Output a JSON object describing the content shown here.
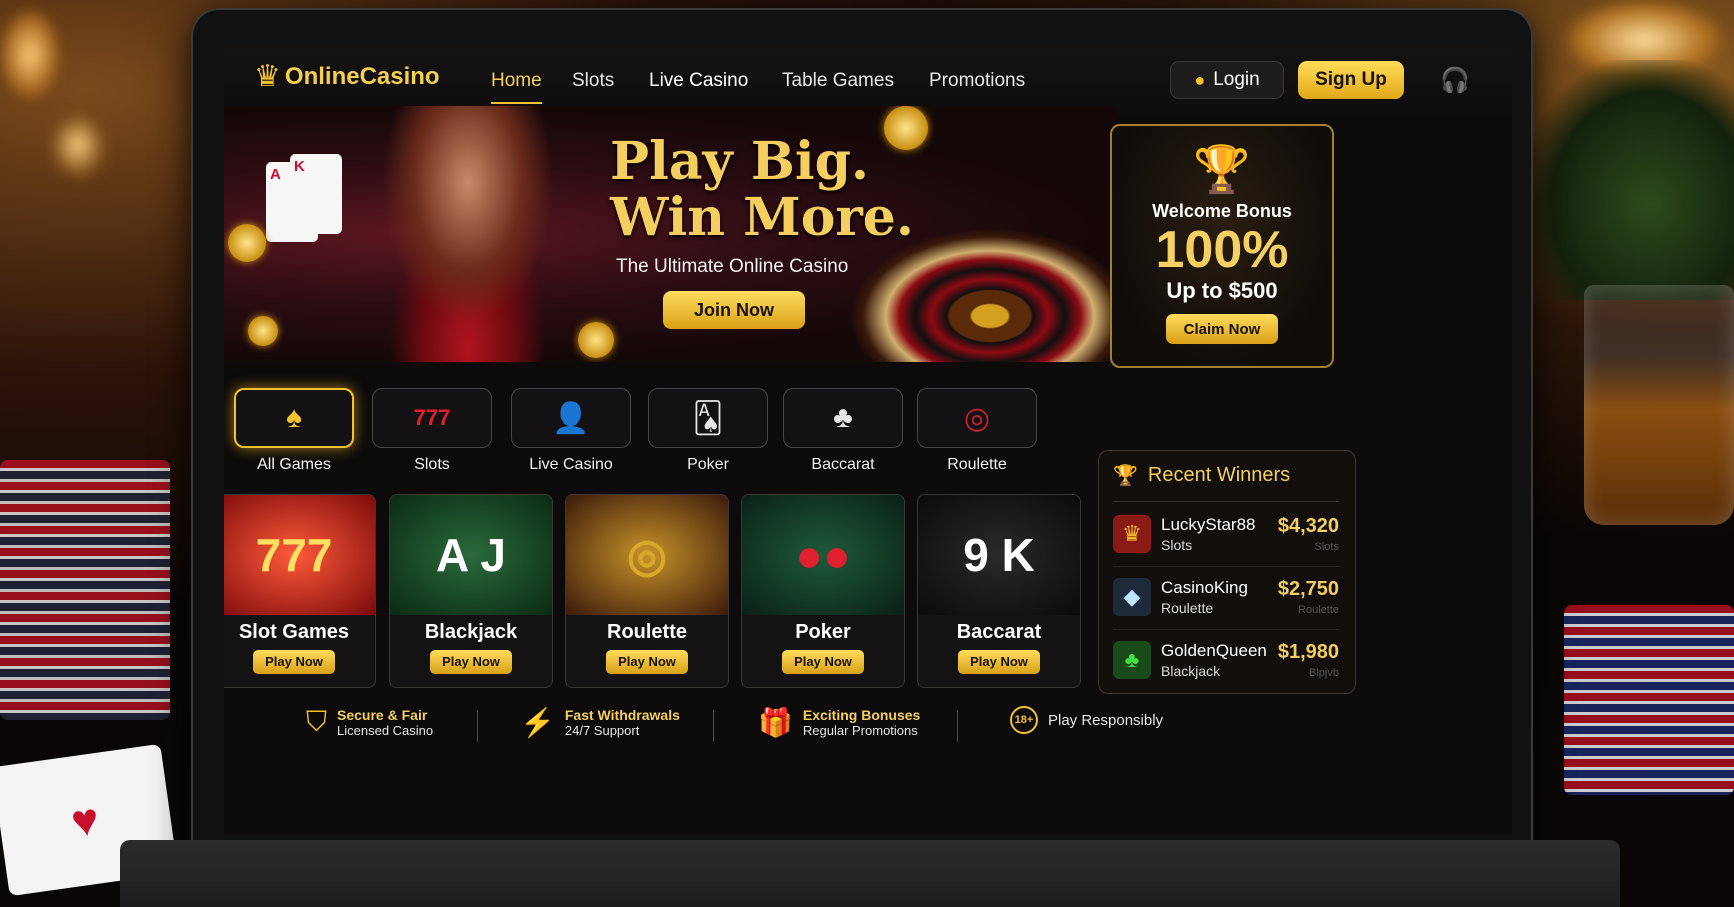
{
  "nav": {
    "logo": "OnlineCasino",
    "links": [
      "Home",
      "Slots",
      "Live Casino",
      "Table Games",
      "Promotions"
    ],
    "login": "Login",
    "signup": "Sign Up"
  },
  "hero": {
    "headline1": "Play Big.",
    "headline2": "Win More.",
    "tagline": "The Ultimate Online Casino",
    "cta": "Join Now",
    "card_rank1": "A",
    "card_rank2": "K"
  },
  "bonus": {
    "label": "Welcome Bonus",
    "percent": "100%",
    "upto": "Up to $500",
    "cta": "Claim Now"
  },
  "categories": [
    {
      "label": "All Games",
      "icon": "spade-icon"
    },
    {
      "label": "Slots",
      "icon": "slot-777-icon"
    },
    {
      "label": "Live Casino",
      "icon": "dealer-icon"
    },
    {
      "label": "Poker",
      "icon": "cards-icon"
    },
    {
      "label": "Baccarat",
      "icon": "club-icon"
    },
    {
      "label": "Roulette",
      "icon": "roulette-wheel-icon"
    }
  ],
  "games": [
    {
      "title": "Slot Games",
      "cta": "Play Now",
      "art": "777"
    },
    {
      "title": "Blackjack",
      "cta": "Play Now",
      "art": "A J"
    },
    {
      "title": "Roulette",
      "cta": "Play Now",
      "art": "◎"
    },
    {
      "title": "Poker",
      "cta": "Play Now",
      "art": "●●"
    },
    {
      "title": "Baccarat",
      "cta": "Play Now",
      "art": "9 K"
    }
  ],
  "winners": {
    "title": "Recent Winners",
    "rows": [
      {
        "name": "LuckyStar88",
        "game": "Slots",
        "amount": "$4,320",
        "game_faded": "Slots"
      },
      {
        "name": "CasinoKing",
        "game": "Roulette",
        "amount": "$2,750",
        "game_faded": "Roulette"
      },
      {
        "name": "GoldenQueen",
        "game": "Blackjack",
        "amount": "$1,980",
        "game_faded": "Blpjvb"
      }
    ]
  },
  "features": [
    {
      "title": "Secure & Fair",
      "sub": "Licensed Casino"
    },
    {
      "title": "Fast Withdrawals",
      "sub": "24/7 Support"
    },
    {
      "title": "Exciting Bonuses",
      "sub": "Regular Promotions"
    },
    {
      "title": "",
      "sub": "Play Responsibly",
      "badge": "18+"
    }
  ],
  "colors": {
    "accent": "#f2c230",
    "bg": "#0c0a0a",
    "card": "#141212"
  }
}
